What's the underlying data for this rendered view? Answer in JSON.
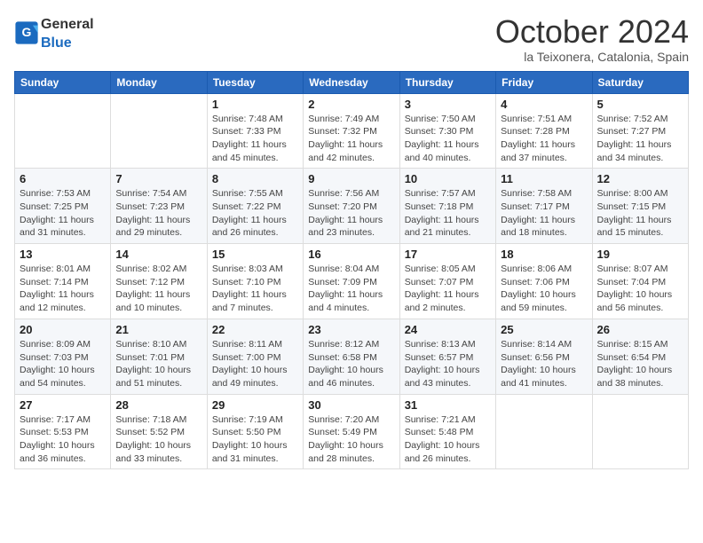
{
  "logo": {
    "general": "General",
    "blue": "Blue"
  },
  "header": {
    "month": "October 2024",
    "location": "la Teixonera, Catalonia, Spain"
  },
  "days_of_week": [
    "Sunday",
    "Monday",
    "Tuesday",
    "Wednesday",
    "Thursday",
    "Friday",
    "Saturday"
  ],
  "weeks": [
    [
      {
        "day": "",
        "info": ""
      },
      {
        "day": "",
        "info": ""
      },
      {
        "day": "1",
        "info": "Sunrise: 7:48 AM\nSunset: 7:33 PM\nDaylight: 11 hours and 45 minutes."
      },
      {
        "day": "2",
        "info": "Sunrise: 7:49 AM\nSunset: 7:32 PM\nDaylight: 11 hours and 42 minutes."
      },
      {
        "day": "3",
        "info": "Sunrise: 7:50 AM\nSunset: 7:30 PM\nDaylight: 11 hours and 40 minutes."
      },
      {
        "day": "4",
        "info": "Sunrise: 7:51 AM\nSunset: 7:28 PM\nDaylight: 11 hours and 37 minutes."
      },
      {
        "day": "5",
        "info": "Sunrise: 7:52 AM\nSunset: 7:27 PM\nDaylight: 11 hours and 34 minutes."
      }
    ],
    [
      {
        "day": "6",
        "info": "Sunrise: 7:53 AM\nSunset: 7:25 PM\nDaylight: 11 hours and 31 minutes."
      },
      {
        "day": "7",
        "info": "Sunrise: 7:54 AM\nSunset: 7:23 PM\nDaylight: 11 hours and 29 minutes."
      },
      {
        "day": "8",
        "info": "Sunrise: 7:55 AM\nSunset: 7:22 PM\nDaylight: 11 hours and 26 minutes."
      },
      {
        "day": "9",
        "info": "Sunrise: 7:56 AM\nSunset: 7:20 PM\nDaylight: 11 hours and 23 minutes."
      },
      {
        "day": "10",
        "info": "Sunrise: 7:57 AM\nSunset: 7:18 PM\nDaylight: 11 hours and 21 minutes."
      },
      {
        "day": "11",
        "info": "Sunrise: 7:58 AM\nSunset: 7:17 PM\nDaylight: 11 hours and 18 minutes."
      },
      {
        "day": "12",
        "info": "Sunrise: 8:00 AM\nSunset: 7:15 PM\nDaylight: 11 hours and 15 minutes."
      }
    ],
    [
      {
        "day": "13",
        "info": "Sunrise: 8:01 AM\nSunset: 7:14 PM\nDaylight: 11 hours and 12 minutes."
      },
      {
        "day": "14",
        "info": "Sunrise: 8:02 AM\nSunset: 7:12 PM\nDaylight: 11 hours and 10 minutes."
      },
      {
        "day": "15",
        "info": "Sunrise: 8:03 AM\nSunset: 7:10 PM\nDaylight: 11 hours and 7 minutes."
      },
      {
        "day": "16",
        "info": "Sunrise: 8:04 AM\nSunset: 7:09 PM\nDaylight: 11 hours and 4 minutes."
      },
      {
        "day": "17",
        "info": "Sunrise: 8:05 AM\nSunset: 7:07 PM\nDaylight: 11 hours and 2 minutes."
      },
      {
        "day": "18",
        "info": "Sunrise: 8:06 AM\nSunset: 7:06 PM\nDaylight: 10 hours and 59 minutes."
      },
      {
        "day": "19",
        "info": "Sunrise: 8:07 AM\nSunset: 7:04 PM\nDaylight: 10 hours and 56 minutes."
      }
    ],
    [
      {
        "day": "20",
        "info": "Sunrise: 8:09 AM\nSunset: 7:03 PM\nDaylight: 10 hours and 54 minutes."
      },
      {
        "day": "21",
        "info": "Sunrise: 8:10 AM\nSunset: 7:01 PM\nDaylight: 10 hours and 51 minutes."
      },
      {
        "day": "22",
        "info": "Sunrise: 8:11 AM\nSunset: 7:00 PM\nDaylight: 10 hours and 49 minutes."
      },
      {
        "day": "23",
        "info": "Sunrise: 8:12 AM\nSunset: 6:58 PM\nDaylight: 10 hours and 46 minutes."
      },
      {
        "day": "24",
        "info": "Sunrise: 8:13 AM\nSunset: 6:57 PM\nDaylight: 10 hours and 43 minutes."
      },
      {
        "day": "25",
        "info": "Sunrise: 8:14 AM\nSunset: 6:56 PM\nDaylight: 10 hours and 41 minutes."
      },
      {
        "day": "26",
        "info": "Sunrise: 8:15 AM\nSunset: 6:54 PM\nDaylight: 10 hours and 38 minutes."
      }
    ],
    [
      {
        "day": "27",
        "info": "Sunrise: 7:17 AM\nSunset: 5:53 PM\nDaylight: 10 hours and 36 minutes."
      },
      {
        "day": "28",
        "info": "Sunrise: 7:18 AM\nSunset: 5:52 PM\nDaylight: 10 hours and 33 minutes."
      },
      {
        "day": "29",
        "info": "Sunrise: 7:19 AM\nSunset: 5:50 PM\nDaylight: 10 hours and 31 minutes."
      },
      {
        "day": "30",
        "info": "Sunrise: 7:20 AM\nSunset: 5:49 PM\nDaylight: 10 hours and 28 minutes."
      },
      {
        "day": "31",
        "info": "Sunrise: 7:21 AM\nSunset: 5:48 PM\nDaylight: 10 hours and 26 minutes."
      },
      {
        "day": "",
        "info": ""
      },
      {
        "day": "",
        "info": ""
      }
    ]
  ]
}
